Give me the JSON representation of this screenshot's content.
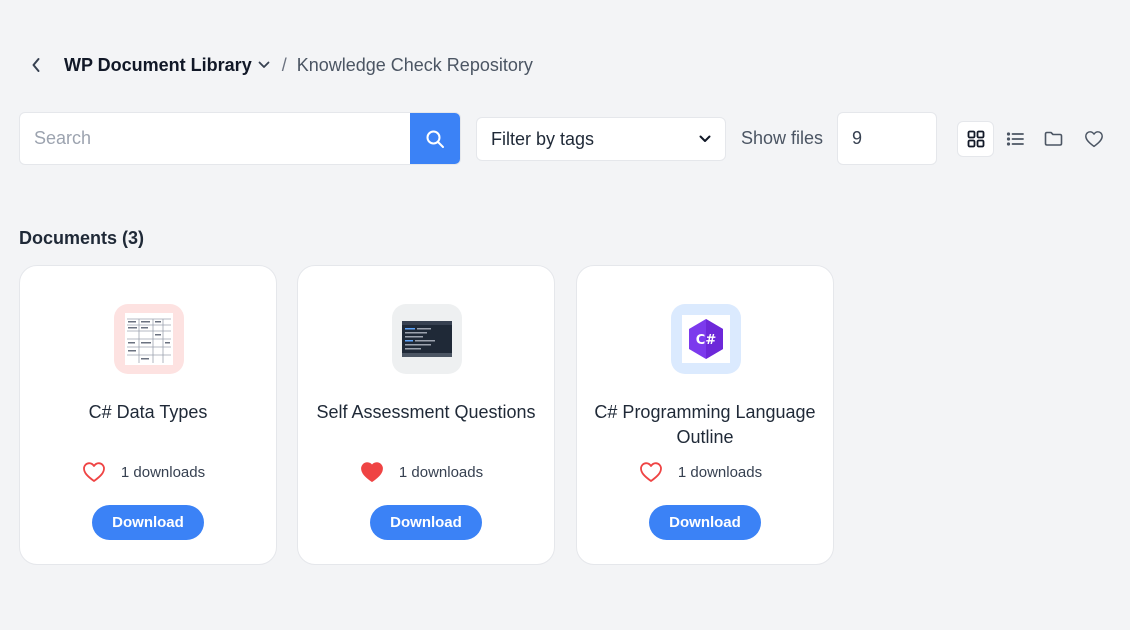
{
  "breadcrumb": {
    "library": "WP Document Library",
    "separator": "/",
    "current": "Knowledge Check Repository"
  },
  "toolbar": {
    "search_placeholder": "Search",
    "search_value": "",
    "tag_filter_label": "Filter by tags",
    "show_files_label": "Show files",
    "show_files_value": "9",
    "views": [
      "grid-view-icon",
      "list-view-icon",
      "folder-view-icon",
      "favorites-icon"
    ],
    "active_view": "grid"
  },
  "section": {
    "title": "Documents",
    "count": "(3)"
  },
  "documents": [
    {
      "title": "C# Data Types",
      "downloads": "1 downloads",
      "favorited": false,
      "download_label": "Download",
      "thumb_bg": "#fde2e1"
    },
    {
      "title": "Self Assessment Questions",
      "downloads": "1 downloads",
      "favorited": true,
      "download_label": "Download",
      "thumb_bg": "#eef0f1"
    },
    {
      "title": "C# Programming Language Outline",
      "downloads": "1 downloads",
      "favorited": false,
      "download_label": "Download",
      "thumb_bg": "#dbeafe"
    }
  ],
  "colors": {
    "accent": "#3b82f6",
    "heart": "#ef4444",
    "csharp_purple": "#7c3aed"
  }
}
